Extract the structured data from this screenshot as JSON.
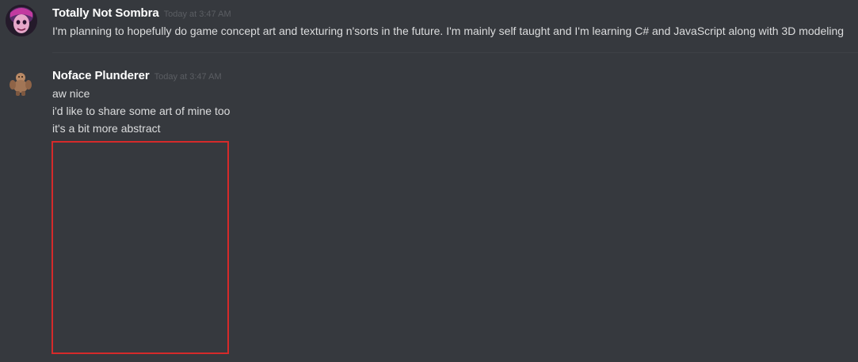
{
  "messages": [
    {
      "author": "Totally Not Sombra",
      "timestamp": "Today at 3:47 AM",
      "lines": [
        "I'm planning to hopefully do game concept art and texturing n'sorts in the future. I'm mainly self taught and I'm learning C# and JavaScript along with 3D modeling"
      ]
    },
    {
      "author": "Noface Plunderer",
      "timestamp": "Today at 3:47 AM",
      "lines": [
        "aw nice",
        "i'd like to share some art of mine too",
        "it's a bit more abstract"
      ]
    }
  ],
  "colors": {
    "background": "#36393e",
    "username": "#ffffff",
    "message_text": "#dcddde",
    "timestamp": "#5b5e63",
    "attachment_border": "#d52a2a"
  }
}
